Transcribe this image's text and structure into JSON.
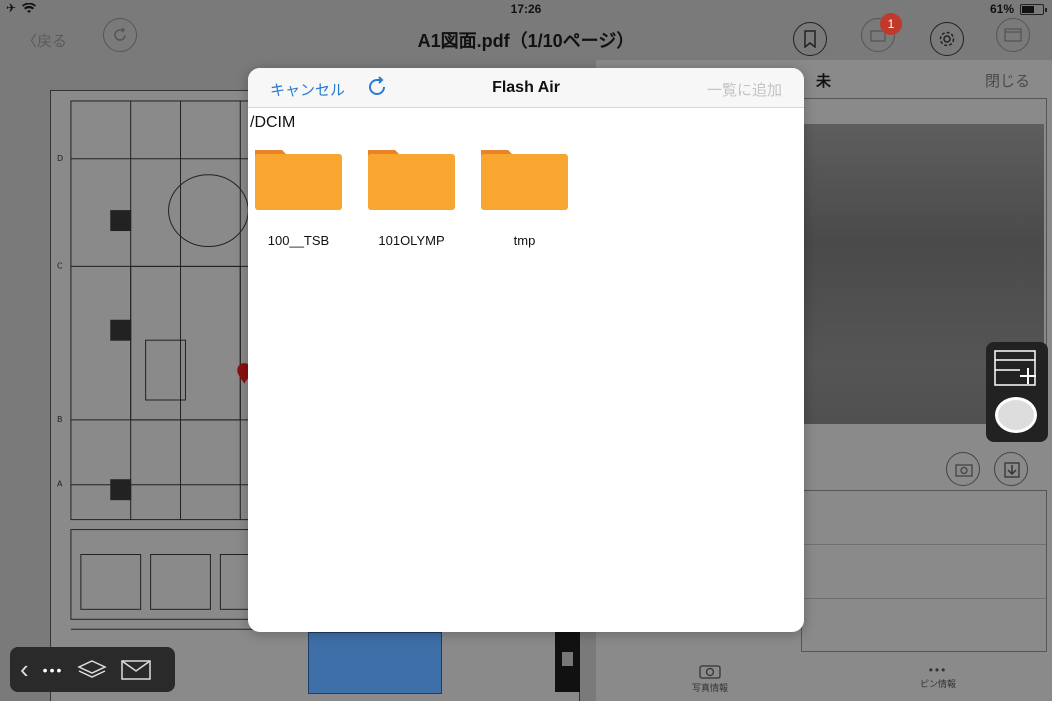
{
  "status_bar": {
    "time": "17:26",
    "battery_text": "61%",
    "battery_level": 0.61
  },
  "nav_bar": {
    "back_label": "戻る",
    "title": "A1図面.pdf（1/10ページ）",
    "notification_count": "1"
  },
  "right_panel": {
    "name": "未",
    "close_label": "閉じる",
    "tabs": [
      {
        "label": "写真情報"
      },
      {
        "label": "ピン情報"
      }
    ]
  },
  "modal": {
    "cancel_label": "キャンセル",
    "title": "Flash Air",
    "add_label": "一覧に追加",
    "path": "/DCIM",
    "folders": [
      {
        "name": "100__TSB"
      },
      {
        "name": "101OLYMP"
      },
      {
        "name": "tmp"
      }
    ]
  },
  "colors": {
    "folder": "#f9a631",
    "folder_tab": "#e8832a",
    "accent": "#2a7bd1",
    "badge": "#c0392b"
  }
}
